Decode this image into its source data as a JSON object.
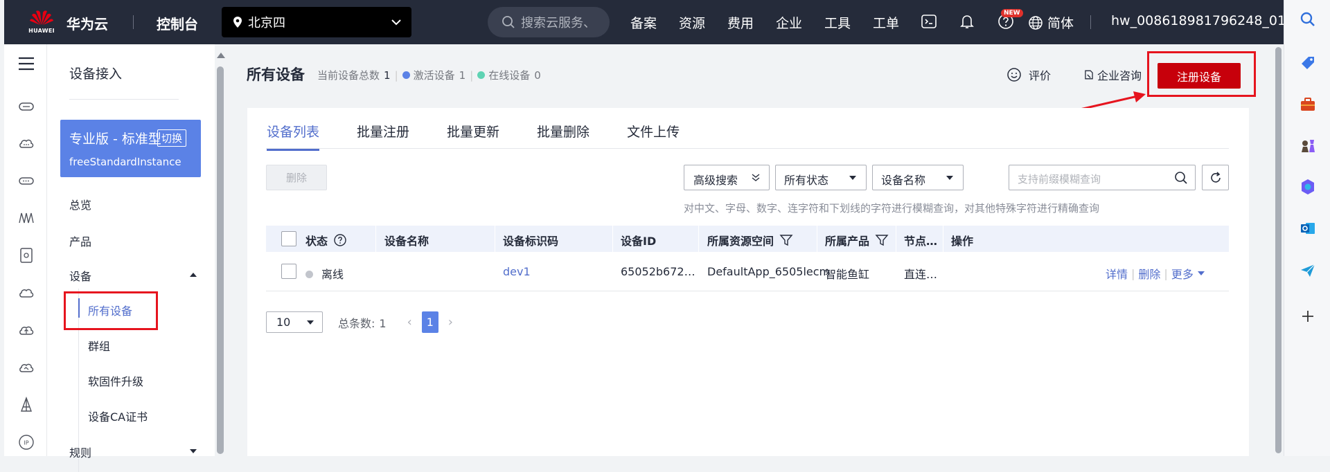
{
  "topbar": {
    "logo_text": "HUAWEI",
    "brand": "华为云",
    "console": "控制台",
    "region": "北京四",
    "search_placeholder": "搜索云服务、",
    "nav": [
      "备案",
      "资源",
      "费用",
      "企业",
      "工具",
      "工单"
    ],
    "new_badge": "NEW",
    "language": "简体",
    "account": "hw_008618981796248_01"
  },
  "sidebar": {
    "title": "设备接入",
    "edition_name": "专业版 - 标准型",
    "edition_switch": "切换",
    "instance_id": "freeStandardInstance",
    "items": {
      "overview": "总览",
      "product": "产品",
      "device": "设备",
      "all_devices": "所有设备",
      "group": "群组",
      "firmware": "软固件升级",
      "ca_cert": "设备CA证书",
      "rules": "规则"
    }
  },
  "main": {
    "title": "所有设备",
    "summary": {
      "total_label": "当前设备总数",
      "total": "1",
      "active_label": "激活设备",
      "active": "1",
      "online_label": "在线设备",
      "online": "0",
      "active_color": "#5b82e6",
      "online_color": "#5fd3b3"
    },
    "rate_label": "评价",
    "consult_label": "企业咨询",
    "register_label": "注册设备",
    "tabs": [
      "设备列表",
      "批量注册",
      "批量更新",
      "批量删除",
      "文件上传"
    ],
    "delete_label": "删除",
    "advanced_search": "高级搜索",
    "status_filter": "所有状态",
    "field_filter": "设备名称",
    "query_placeholder": "支持前缀模糊查询",
    "hint": "对中文、字母、数字、连字符和下划线的字符进行模糊查询，对其他特殊字符进行精确查询",
    "columns": [
      "状态",
      "设备名称",
      "设备标识码",
      "设备ID",
      "所属资源空间",
      "所属产品",
      "节点…",
      "操作"
    ],
    "rows": [
      {
        "status": "离线",
        "name": "",
        "node_id": "dev1",
        "device_id": "65052b672…",
        "space": "DefaultApp_6505lecm",
        "product": "智能鱼缸",
        "node_type": "直连…",
        "actions": [
          "详情",
          "删除",
          "更多"
        ]
      }
    ],
    "pagination": {
      "page_size": "10",
      "total_label": "总条数:",
      "total": "1",
      "current_page": "1"
    }
  },
  "accent_color": "#526ecc",
  "brand_red": "#c7000b",
  "icons": [
    "search-icon",
    "terminal-icon",
    "bell-icon",
    "help-icon",
    "globe-icon",
    "location-icon",
    "chevron-down-icon",
    "filter-icon",
    "refresh-icon",
    "smile-icon",
    "consult-icon"
  ]
}
